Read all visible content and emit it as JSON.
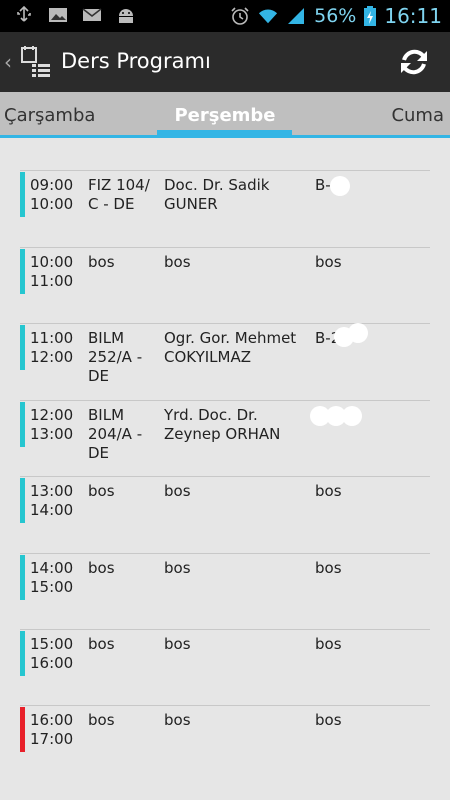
{
  "status_bar": {
    "battery_percent": "56%",
    "time": "16:11",
    "icons": [
      "usb-icon",
      "image-icon",
      "mail-icon",
      "android-icon",
      "alarm-icon",
      "wifi-icon",
      "signal-icon",
      "battery-icon"
    ]
  },
  "action_bar": {
    "title": "Ders Programı",
    "icons": [
      "back-caret-icon",
      "calendar-list-icon",
      "refresh-icon"
    ]
  },
  "tabs": {
    "prev": "Çarşamba",
    "current": "Perşembe",
    "next": "Cuma"
  },
  "colors": {
    "accent": "#33b5e5",
    "row_normal": "#26c6d0",
    "row_current": "#e8202a"
  },
  "schedule": [
    {
      "time": "09:00\n10:00",
      "course": "FIZ 104/\nC - DE",
      "teacher": "Doc. Dr. Sadik\nGUNER",
      "room": "B-   4",
      "status": "normal"
    },
    {
      "time": "10:00\n11:00",
      "course": "bos",
      "teacher": "bos",
      "room": "bos",
      "status": "normal"
    },
    {
      "time": "11:00\n12:00",
      "course": "BILM\n252/A -\nDE",
      "teacher": "Ogr. Gor. Mehmet\nCOKYILMAZ",
      "room": "B-2",
      "status": "normal"
    },
    {
      "time": "12:00\n13:00",
      "course": "BILM\n204/A -\nDE",
      "teacher": "Yrd. Doc. Dr.\nZeynep ORHAN",
      "room": "",
      "status": "normal"
    },
    {
      "time": "13:00\n14:00",
      "course": "bos",
      "teacher": "bos",
      "room": "bos",
      "status": "normal"
    },
    {
      "time": "14:00\n15:00",
      "course": "bos",
      "teacher": "bos",
      "room": "bos",
      "status": "normal"
    },
    {
      "time": "15:00\n16:00",
      "course": "bos",
      "teacher": "bos",
      "room": "bos",
      "status": "normal"
    },
    {
      "time": "16:00\n17:00",
      "course": "bos",
      "teacher": "bos",
      "room": "bos",
      "status": "current"
    }
  ]
}
